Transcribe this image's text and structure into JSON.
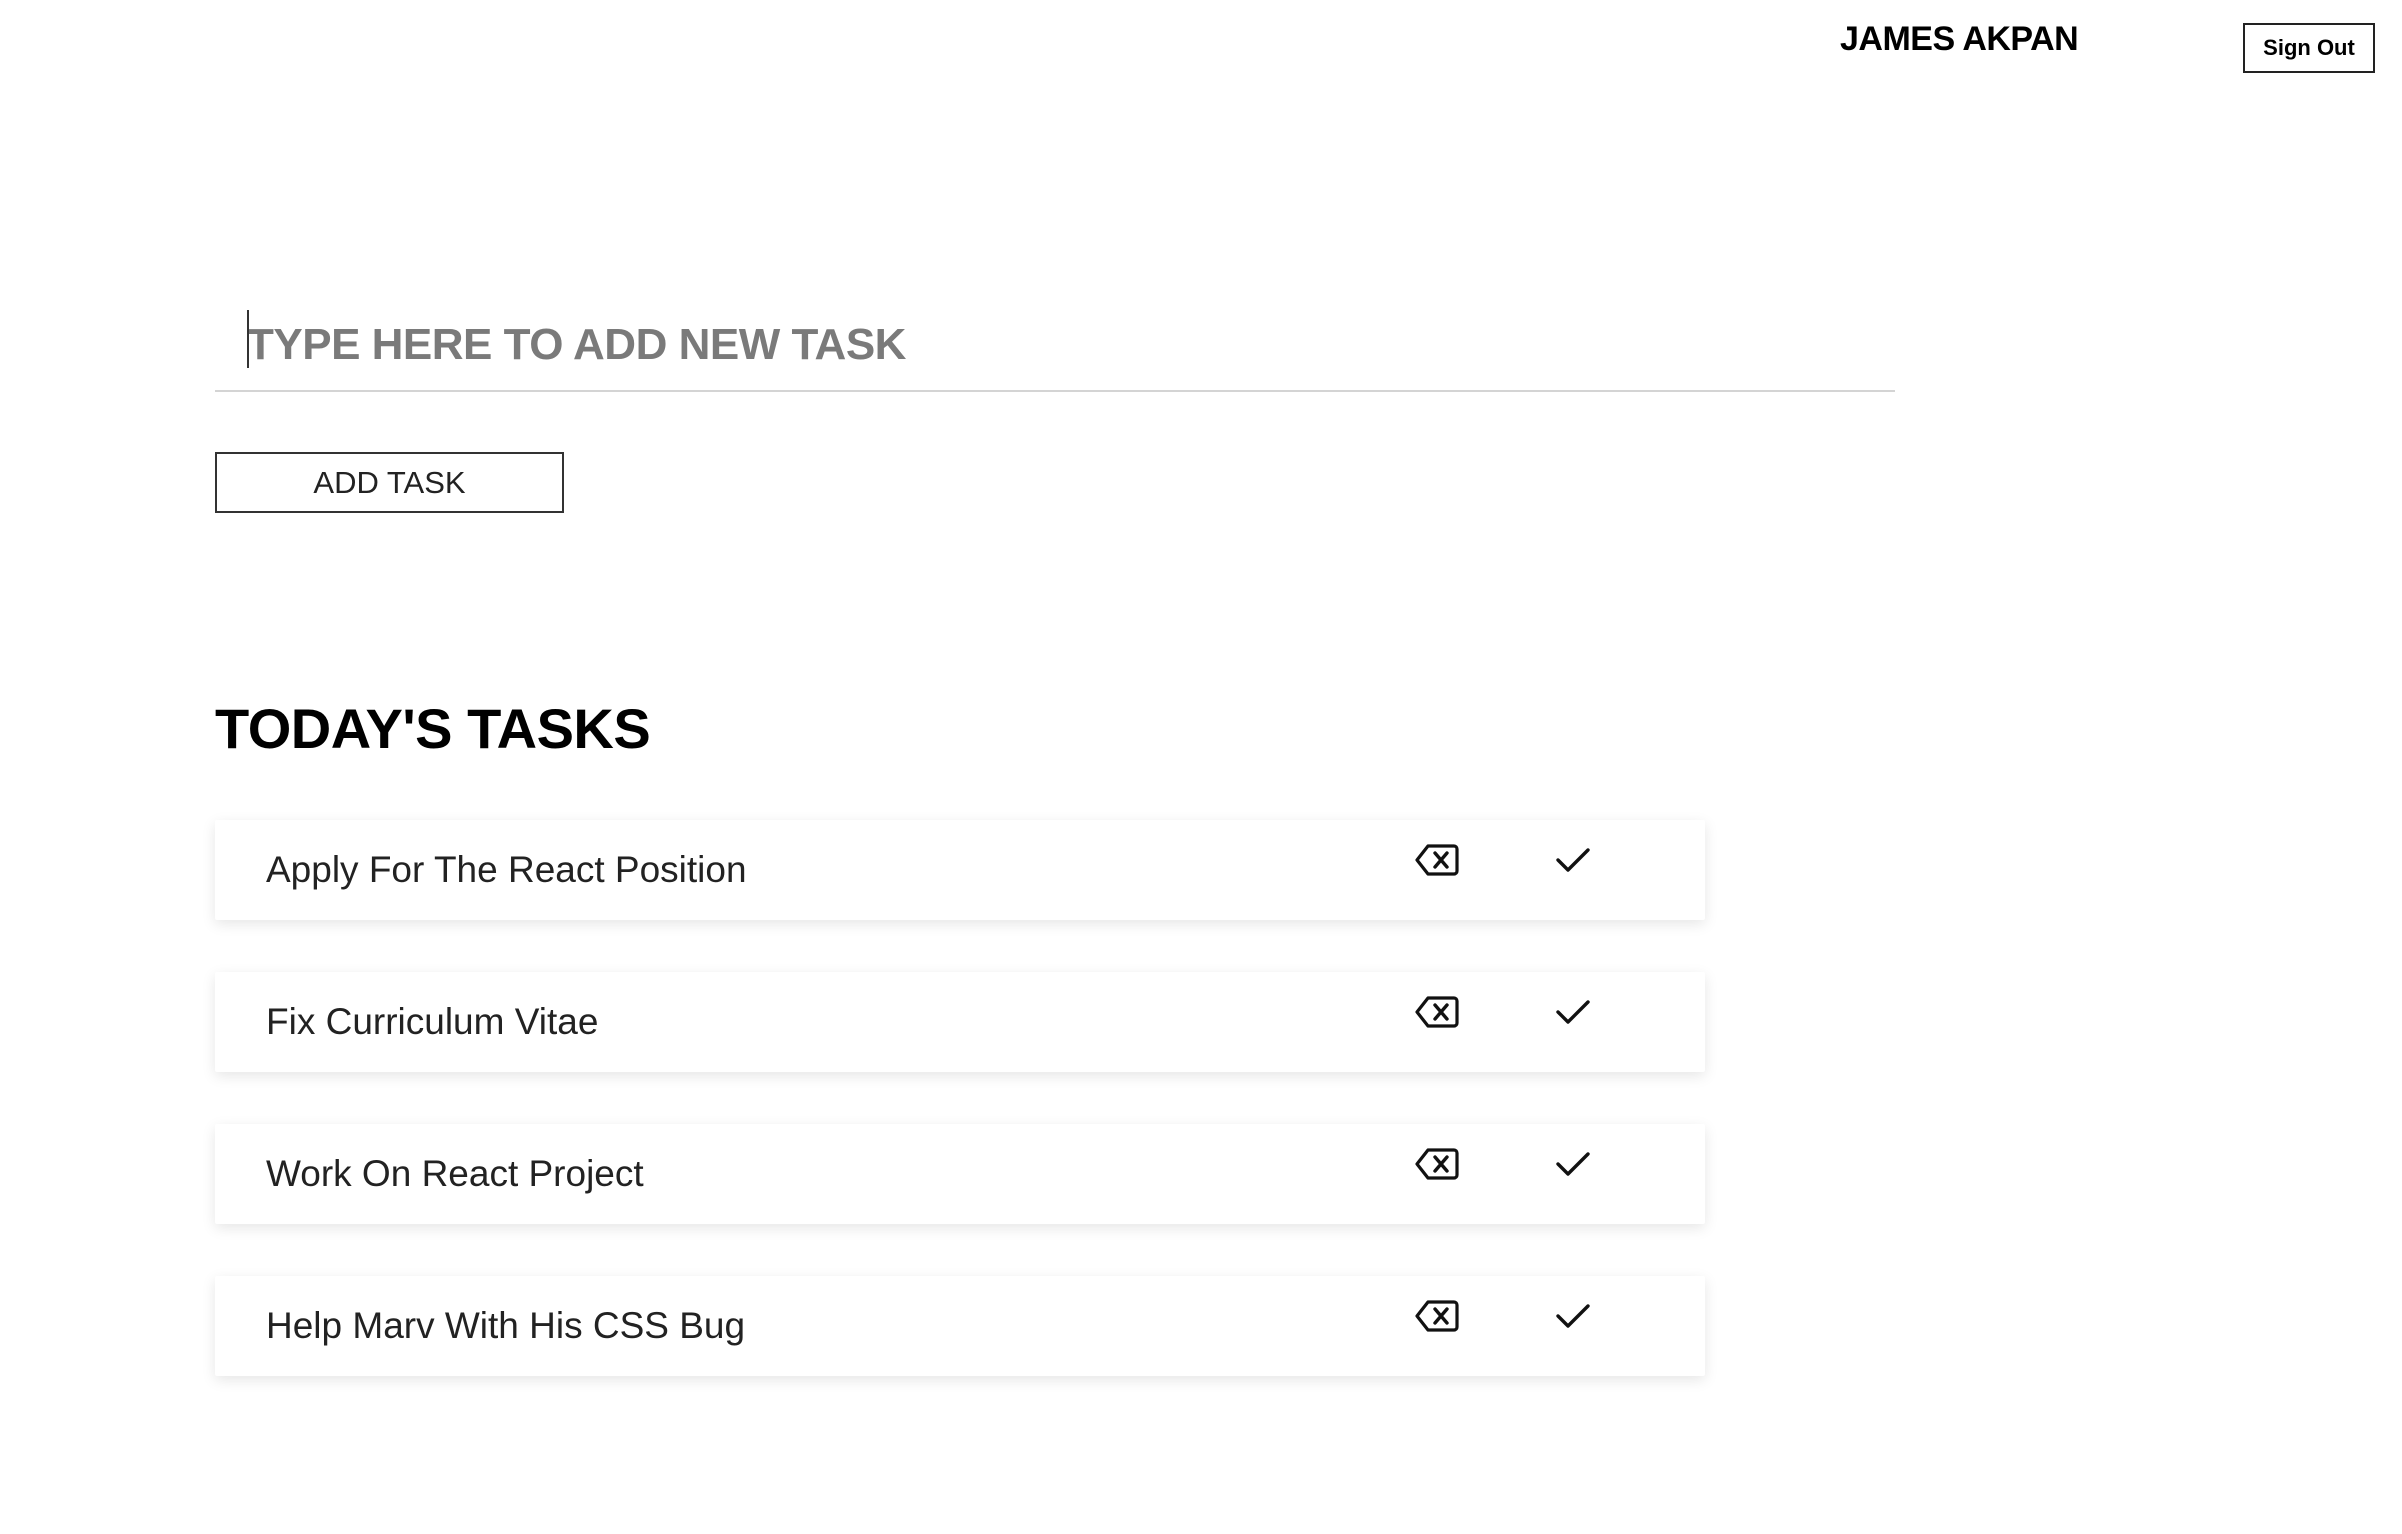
{
  "header": {
    "user_name": "JAMES AKPAN",
    "sign_out_label": "Sign Out"
  },
  "new_task": {
    "placeholder": "TYPE HERE TO ADD NEW TASK",
    "value": "",
    "add_button_label": "ADD TASK"
  },
  "tasks_section": {
    "title": "TODAY'S TASKS",
    "items": [
      {
        "label": "Apply For The React Position",
        "delete_icon": "backspace-delete-icon",
        "complete_icon": "checkmark-icon"
      },
      {
        "label": "Fix Curriculum Vitae",
        "delete_icon": "backspace-delete-icon",
        "complete_icon": "checkmark-icon"
      },
      {
        "label": "Work On React Project",
        "delete_icon": "backspace-delete-icon",
        "complete_icon": "checkmark-icon"
      },
      {
        "label": "Help Marv With His CSS Bug",
        "delete_icon": "backspace-delete-icon",
        "complete_icon": "checkmark-icon"
      }
    ]
  },
  "colors": {
    "background": "#ffffff",
    "text": "#111111",
    "placeholder": "#7a7a7a",
    "divider": "#d4d4d4",
    "border": "#333333"
  }
}
